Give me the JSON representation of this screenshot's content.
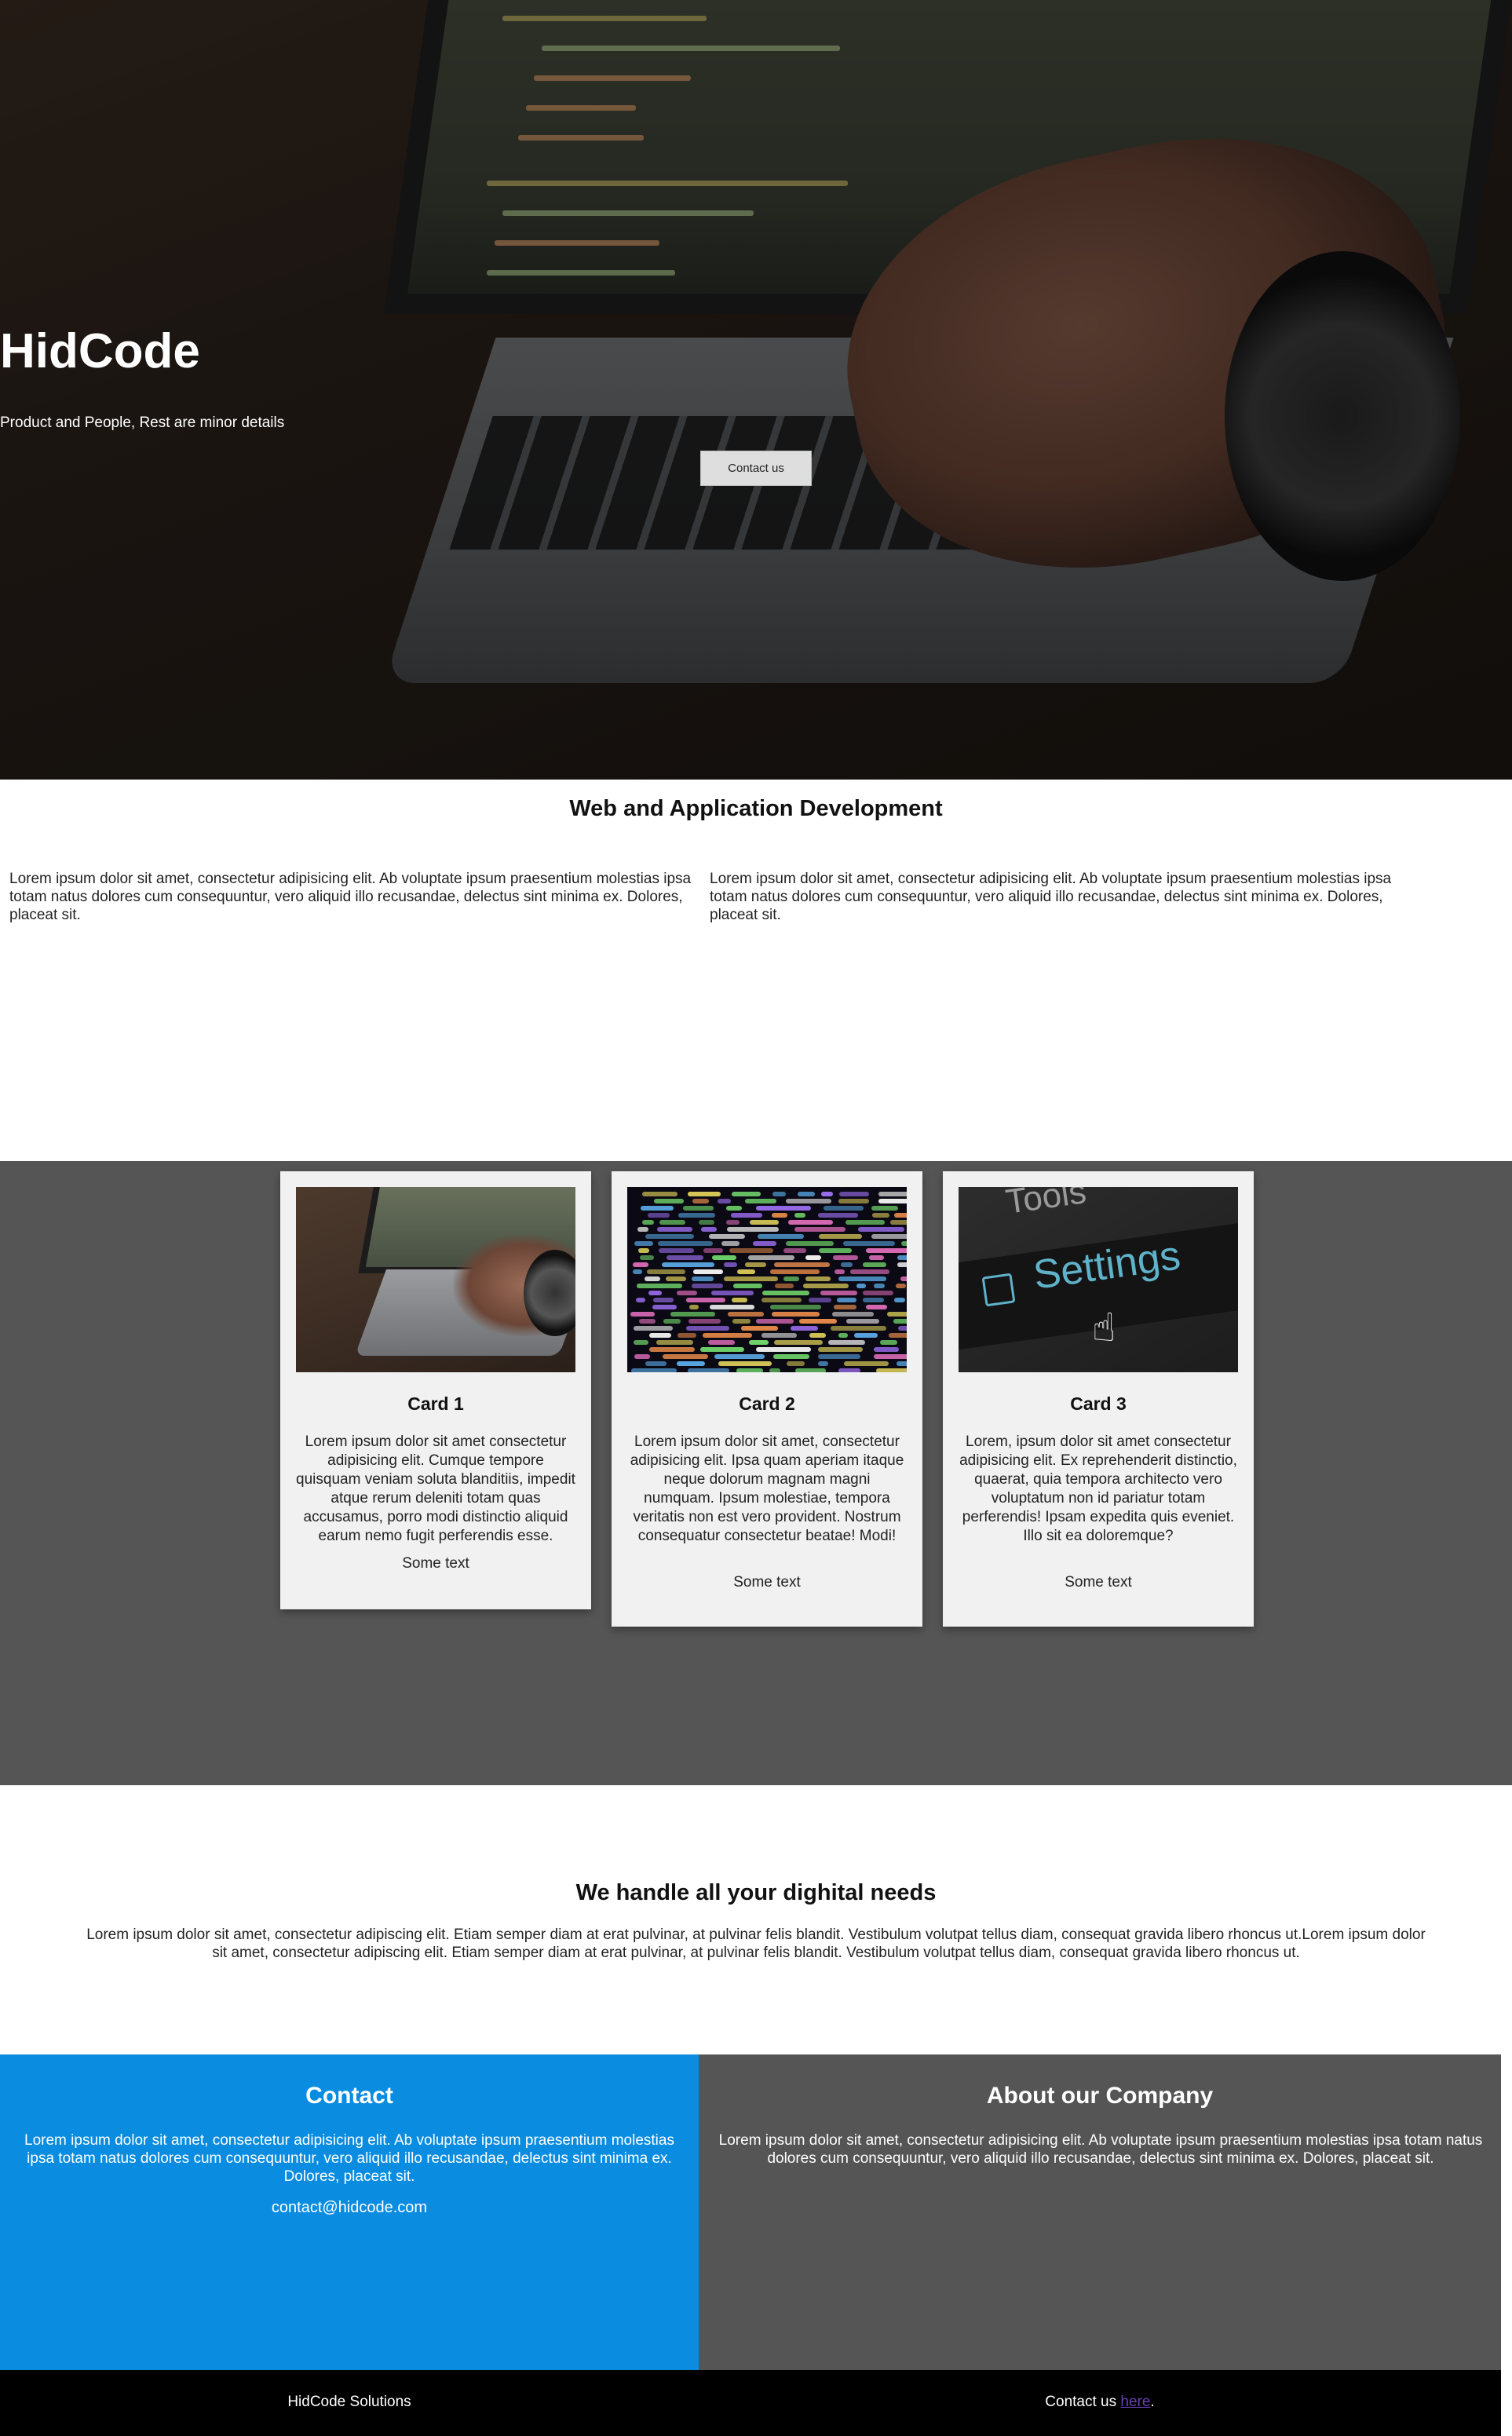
{
  "hero": {
    "title": "HidCode",
    "tagline": "Product and People, Rest are minor details",
    "button_label": "Contact us"
  },
  "services": {
    "title": "Web and Application Development",
    "columns": [
      "Lorem ipsum dolor sit amet, consectetur adipisicing elit. Ab voluptate ipsum praesentium molestias ipsa totam natus dolores cum consequuntur, vero aliquid illo recusandae, delectus sint minima ex. Dolores, placeat sit.",
      "Lorem ipsum dolor sit amet, consectetur adipisicing elit. Ab voluptate ipsum praesentium molestias ipsa totam natus dolores cum consequuntur, vero aliquid illo recusandae, delectus sint minima ex. Dolores, placeat sit."
    ]
  },
  "cards": [
    {
      "title": "Card 1",
      "image_icon": "laptop-typing-image",
      "text": "Lorem ipsum dolor sit amet consectetur adipisicing elit. Cumque tempore quisquam veniam soluta blanditiis, impedit atque rerum deleniti totam quas accusamus, porro modi distinctio aliquid earum nemo fugit perferendis esse.",
      "footer": "Some text"
    },
    {
      "title": "Card 2",
      "image_icon": "colorful-code-image",
      "text": "Lorem ipsum dolor sit amet, consectetur adipisicing elit. Ipsa quam aperiam itaque neque dolorum magnam magni numquam. Ipsum molestiae, tempora veritatis non est vero provident. Nostrum consequatur consectetur beatae! Modi!",
      "footer": "Some text"
    },
    {
      "title": "Card 3",
      "image_icon": "settings-button-image",
      "image_words": [
        "Tools",
        "Settings"
      ],
      "text": "Lorem, ipsum dolor sit amet consectetur adipisicing elit. Ex reprehenderit distinctio, quaerat, quia tempora architecto vero voluptatum non id pariatur totam perferendis! Ipsam expedita quis eveniet. Illo sit ea doloremque?",
      "footer": "Some text"
    }
  ],
  "digital": {
    "title": "We handle all your dighital needs",
    "text": "Lorem ipsum dolor sit amet, consectetur adipiscing elit. Etiam semper diam at erat pulvinar, at pulvinar felis blandit. Vestibulum volutpat tellus diam, consequat gravida libero rhoncus ut.Lorem ipsum dolor sit amet, consectetur adipiscing elit. Etiam semper diam at erat pulvinar, at pulvinar felis blandit. Vestibulum volutpat tellus diam, consequat gravida libero rhoncus ut."
  },
  "contact": {
    "title": "Contact",
    "text": "Lorem ipsum dolor sit amet, consectetur adipisicing elit. Ab voluptate ipsum praesentium molestias ipsa totam natus dolores cum consequuntur, vero aliquid illo recusandae, delectus sint minima ex. Dolores, placeat sit.",
    "email": "contact@hidcode.com"
  },
  "about": {
    "title": "About our Company",
    "text": "Lorem ipsum dolor sit amet, consectetur adipisicing elit. Ab voluptate ipsum praesentium molestias ipsa totam natus dolores cum consequuntur, vero aliquid illo recusandae, delectus sint minima ex. Dolores, placeat sit."
  },
  "footer": {
    "company": "HidCode Solutions",
    "contact_prefix": "Contact us ",
    "contact_link": "here",
    "contact_suffix": "."
  },
  "colors": {
    "contact_panel": "#0a8ce0",
    "dark_panel": "#555555",
    "footer_bar": "#000000",
    "card_bg": "#f1f1f1",
    "link_visited": "#6a3fb5"
  }
}
